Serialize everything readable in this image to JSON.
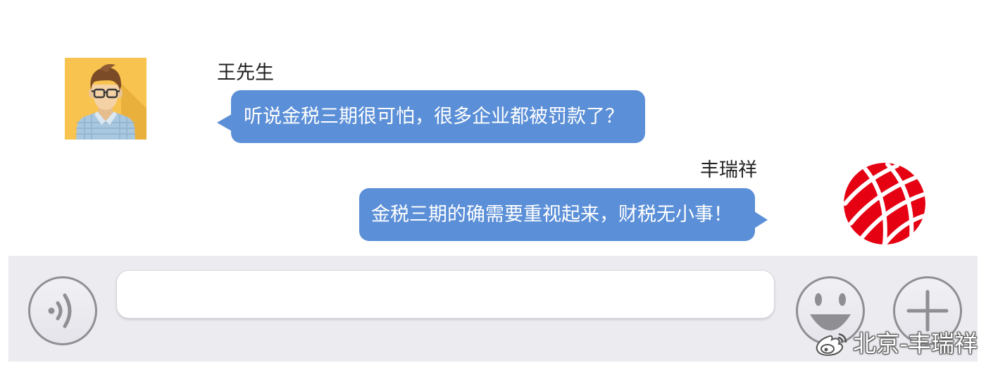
{
  "chat": {
    "messages": [
      {
        "sender": "王先生",
        "text": "听说金税三期很可怕，很多企业都被罚款了？",
        "avatar_icon": "man-with-glasses-avatar"
      },
      {
        "sender": "丰瑞祥",
        "text": "金税三期的确需要重视起来，财税无小事！",
        "avatar_icon": "red-globe-logo-avatar"
      }
    ]
  },
  "input_bar": {
    "voice_button_icon": "voice-icon",
    "message_input": {
      "value": ""
    },
    "emoji_button_icon": "emoji-icon",
    "more_button_icon": "plus-icon"
  },
  "watermark": {
    "icon": "weibo-icon",
    "text": "北京-丰瑞祥"
  },
  "colors": {
    "bubble": "#5b8fd7",
    "bubble_text": "#ffffff",
    "input_bar_background": "#ebebf0",
    "icon_gray": "#8e8e93",
    "avatar_background": "#f8c34e",
    "logo_red": "#e50012"
  }
}
